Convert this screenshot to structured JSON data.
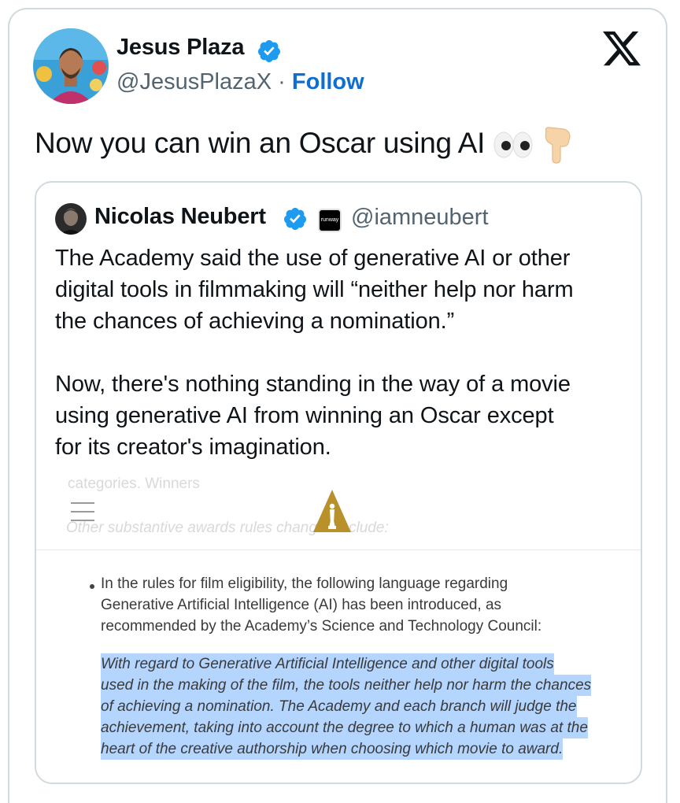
{
  "author": {
    "name": "Jesus Plaza",
    "handle": "@JesusPlazaX",
    "separator": "·",
    "follow_label": "Follow"
  },
  "tweet": {
    "text": "Now you can win an Oscar using AI",
    "emojis": [
      "eyes-emoji",
      "pointing-down-emoji"
    ]
  },
  "quote": {
    "name": "Nicolas Neubert",
    "badge_label": "runway",
    "handle": "@iamneubert",
    "paragraphs": [
      [
        "The Academy said the use of generative AI or other",
        "digital tools in filmmaking will “neither help nor harm",
        "the chances of achieving a nomination.”"
      ],
      [
        "Now, there's nothing standing in the way of a movie",
        "using generative AI from winning an Oscar except",
        "for its creator's imagination."
      ]
    ]
  },
  "screenshot": {
    "ghost_top": "categories. Winners",
    "ghost_text": "Other substantive awards rules changes include:",
    "bullet_lines": [
      "In the rules for film eligibility, the following language regarding",
      "Generative Artificial Intelligence (AI) has been introduced, as",
      "recommended by the Academy’s Science and Technology Council:"
    ],
    "highlight_lines": [
      "With regard to Generative Artificial Intelligence and other digital tools",
      "used in the making of the film, the tools neither help nor harm the chances",
      "of achieving a nomination. The Academy and each branch will judge the",
      "achievement, taking into account the degree to which a human was at the",
      "heart of the creative authorship when choosing which movie to award."
    ],
    "highlight_color": "#b4d5fe"
  },
  "colors": {
    "verified": "#1d9bf0",
    "follow": "#0f6fd1",
    "secondary_text": "#536471",
    "border": "#cfd9de",
    "oscar_gold": "#b8912b"
  }
}
